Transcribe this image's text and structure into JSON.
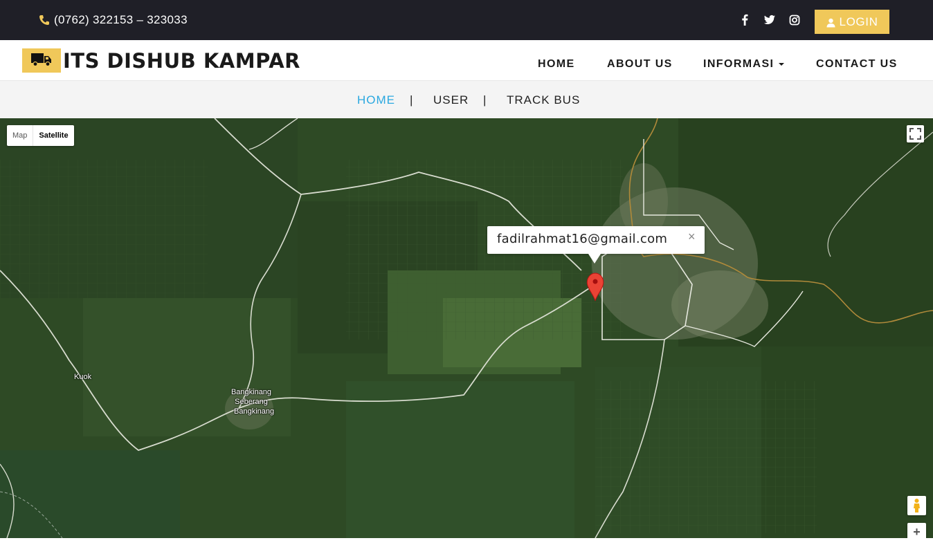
{
  "topbar": {
    "phone": "(0762) 322153 – 323033",
    "phone_icon": "phone-icon",
    "socials": [
      "facebook-icon",
      "twitter-icon",
      "instagram-icon"
    ],
    "login_label": "LOGIN",
    "accent": "#f0c85a",
    "background": "#1f1f27"
  },
  "header": {
    "brand": "ITS DISHUB KAMPAR",
    "logo_icon": "truck-icon",
    "nav": [
      "HOME",
      "ABOUT US",
      "INFORMASI",
      "CONTACT US"
    ]
  },
  "subnav": {
    "items": [
      "HOME",
      "USER",
      "TRACK BUS"
    ],
    "separator": "|",
    "active": "HOME",
    "active_color": "#2aa8e0"
  },
  "map": {
    "type_options": [
      "Map",
      "Satellite"
    ],
    "selected_type": "Satellite",
    "info_window": {
      "text": "fadilrahmat16@gmail.com",
      "close": "×"
    },
    "place_labels": [
      "Kuok",
      "Bangkinang Seberang",
      "Bangkinang"
    ],
    "zoom_in": "+"
  }
}
